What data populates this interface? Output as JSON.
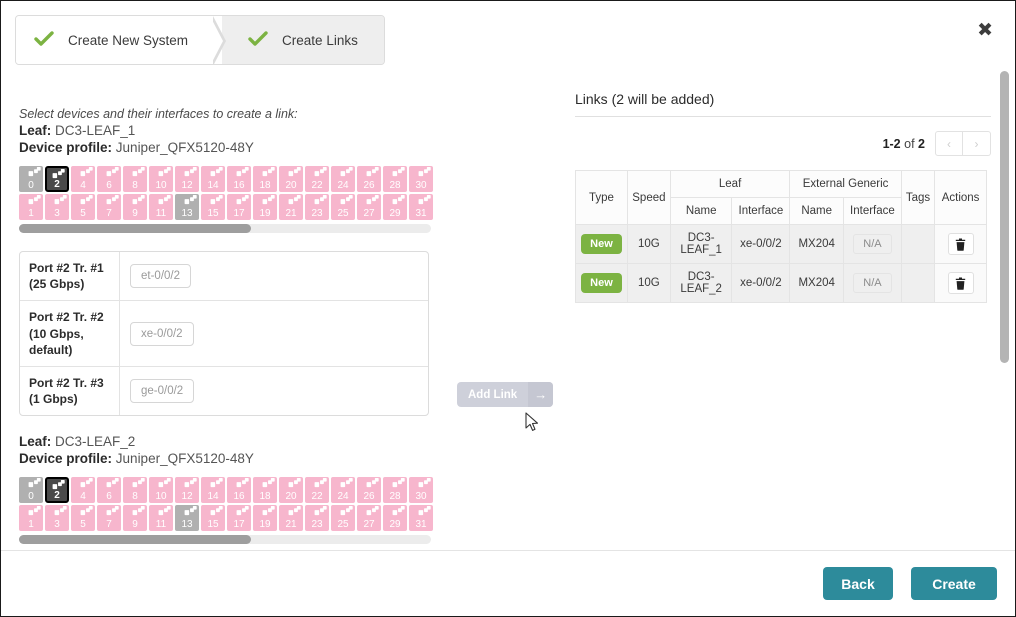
{
  "dialog": {
    "close_icon": "close-icon"
  },
  "steps": [
    {
      "label": "Create New System",
      "state": "done"
    },
    {
      "label": "Create Links",
      "state": "active"
    }
  ],
  "left": {
    "hint": "Select devices and their interfaces to create a link:",
    "devices": [
      {
        "leaf_label": "Leaf:",
        "leaf_name": "DC3-LEAF_1",
        "profile_label": "Device profile:",
        "profile_name": "Juniper_QFX5120-48Y",
        "ports_top": [
          "0",
          "2",
          "4",
          "6",
          "8",
          "10",
          "12",
          "14",
          "16",
          "18",
          "20",
          "22",
          "24",
          "26",
          "28",
          "30"
        ],
        "ports_bottom": [
          "1",
          "3",
          "5",
          "7",
          "9",
          "11",
          "13",
          "15",
          "17",
          "19",
          "21",
          "23",
          "25",
          "27",
          "29",
          "31"
        ],
        "gray_ports": [
          "0",
          "13"
        ],
        "selected_port": "2"
      },
      {
        "leaf_label": "Leaf:",
        "leaf_name": "DC3-LEAF_2",
        "profile_label": "Device profile:",
        "profile_name": "Juniper_QFX5120-48Y",
        "ports_top": [
          "0",
          "2",
          "4",
          "6",
          "8",
          "10",
          "12",
          "14",
          "16",
          "18",
          "20",
          "22",
          "24",
          "26",
          "28",
          "30"
        ],
        "ports_bottom": [
          "1",
          "3",
          "5",
          "7",
          "9",
          "11",
          "13",
          "15",
          "17",
          "19",
          "21",
          "23",
          "25",
          "27",
          "29",
          "31"
        ],
        "gray_ports": [
          "0",
          "13"
        ],
        "selected_port": "2"
      }
    ],
    "transceivers": [
      {
        "label": "Port #2 Tr. #1 (25 Gbps)",
        "interface": "et-0/0/2"
      },
      {
        "label": "Port #2 Tr. #2 (10 Gbps, default)",
        "interface": "xe-0/0/2"
      },
      {
        "label": "Port #2 Tr. #3 (1 Gbps)",
        "interface": "ge-0/0/2"
      }
    ],
    "add_link": {
      "label": "Add Link",
      "arrow": "→",
      "enabled": false
    }
  },
  "right": {
    "title": "Links (2 will be added)",
    "pagination": {
      "range": "1-2",
      "of_word": "of",
      "total": "2",
      "prev": "‹",
      "next": "›"
    },
    "table": {
      "headers": {
        "type": "Type",
        "speed": "Speed",
        "leaf_group": "Leaf",
        "external_group": "External Generic",
        "name": "Name",
        "interface": "Interface",
        "tags": "Tags",
        "actions": "Actions"
      },
      "rows": [
        {
          "type": "New",
          "speed": "10G",
          "leaf_name": "DC3-LEAF_1",
          "leaf_interface": "xe-0/0/2",
          "ext_name": "MX204",
          "ext_interface": "N/A",
          "tags": "",
          "action_icon": "trash-icon"
        },
        {
          "type": "New",
          "speed": "10G",
          "leaf_name": "DC3-LEAF_2",
          "leaf_interface": "xe-0/0/2",
          "ext_name": "MX204",
          "ext_interface": "N/A",
          "tags": "",
          "action_icon": "trash-icon"
        }
      ]
    }
  },
  "footer": {
    "back": "Back",
    "create": "Create"
  },
  "colors": {
    "accent_teal": "#2d8b9b",
    "badge_green": "#7cb342",
    "port_pink": "#f7b6cd",
    "port_gray": "#b0b0b0",
    "port_selected": "#4a4a4a"
  }
}
